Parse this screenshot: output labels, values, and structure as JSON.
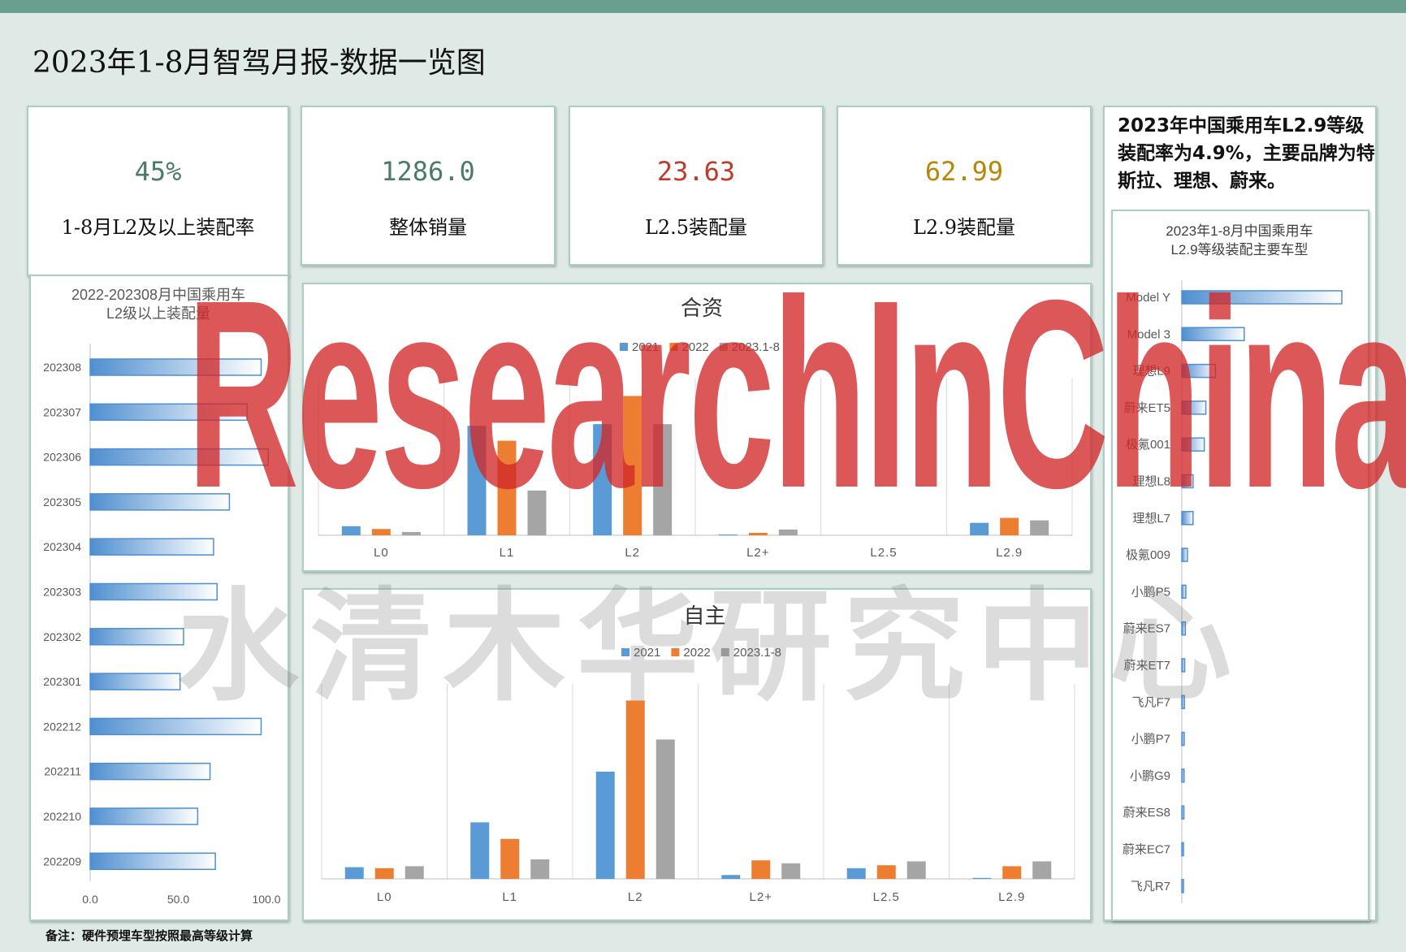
{
  "title": "2023年1-8月智驾月报-数据一览图",
  "kpis": [
    {
      "value": "45%",
      "label": "1-8月L2及以上装配率",
      "color": "#4a7a6a"
    },
    {
      "value": "1286.0",
      "label": "整体销量",
      "color": "#4a7a6a"
    },
    {
      "value": "23.63",
      "label": "L2.5装配量",
      "color": "#c0392b"
    },
    {
      "value": "62.99",
      "label": "L2.9装配量",
      "color": "#b8860b"
    }
  ],
  "summary": "2023年中国乘用车L2.9等级装配率为4.9%，主要品牌为特斯拉、理想、蔚来。",
  "footnote": "备注：硬件预埋车型按照最高等级计算",
  "watermark": {
    "en": "ResearchInChina",
    "cn": "水清木华研究中心"
  },
  "colors": {
    "blue": "#5b9bd5",
    "orange": "#ed7d31",
    "gray": "#a5a5a5"
  },
  "chart_data": [
    {
      "id": "monthly",
      "type": "bar",
      "orientation": "horizontal",
      "title": "2022-202308月中国乘用车L2级以上装配量",
      "title_lines": [
        "2022-202308月中国乘用车",
        "L2级以上装配量"
      ],
      "categories": [
        "202308",
        "202307",
        "202306",
        "202305",
        "202304",
        "202303",
        "202302",
        "202301",
        "202212",
        "202211",
        "202210",
        "202209"
      ],
      "values": [
        97,
        89,
        101,
        79,
        70,
        72,
        53,
        51,
        97,
        68,
        61,
        71
      ],
      "xlim": [
        0,
        100
      ],
      "xticks": [
        "0.0",
        "50.0",
        "100.0"
      ],
      "legend": "none"
    },
    {
      "id": "jv",
      "type": "bar",
      "title": "合资",
      "categories": [
        "L0",
        "L1",
        "L2",
        "L2+",
        "L2.5",
        "L2.9"
      ],
      "series": [
        {
          "name": "2021",
          "values": [
            5.5,
            66,
            67,
            0.5,
            0,
            7.5
          ]
        },
        {
          "name": "2022",
          "values": [
            3.8,
            57,
            84,
            1.5,
            0,
            10.5
          ]
        },
        {
          "name": "2023.1-8",
          "values": [
            2.0,
            27,
            67,
            3.5,
            0,
            9
          ]
        }
      ],
      "ylim": [
        0,
        95
      ],
      "legend": "top"
    },
    {
      "id": "domestic",
      "type": "bar",
      "title": "自主",
      "categories": [
        "L0",
        "L1",
        "L2",
        "L2+",
        "L2.5",
        "L2.9"
      ],
      "series": [
        {
          "name": "2021",
          "values": [
            6,
            29,
            55,
            2,
            5.5,
            0.5
          ]
        },
        {
          "name": "2022",
          "values": [
            5.5,
            20.5,
            91.5,
            9.5,
            7,
            6.5
          ]
        },
        {
          "name": "2023.1-8",
          "values": [
            6.5,
            10,
            71.5,
            8,
            9,
            9
          ]
        }
      ],
      "ylim": [
        0,
        100
      ],
      "legend": "top"
    },
    {
      "id": "models",
      "type": "bar",
      "orientation": "horizontal",
      "title": "2023年1-8月中国乘用车L2.9等级装配主要车型",
      "title_lines": [
        "2023年1-8月中国乘用车",
        "L2.9等级装配主要车型"
      ],
      "categories": [
        "Model Y",
        "Model 3",
        "理想L9",
        "蔚来ET5",
        "极氪001",
        "理想L8",
        "理想L7",
        "极氪009",
        "小鹏P5",
        "蔚来ES7",
        "蔚来ET7",
        "飞凡F7",
        "小鹏P7",
        "小鹏G9",
        "蔚来ES8",
        "蔚来EC7",
        "飞凡R7"
      ],
      "values": [
        100,
        39,
        21,
        15,
        14,
        7,
        7,
        3.5,
        2.5,
        2.2,
        1.8,
        1.6,
        1.5,
        1.4,
        1.3,
        1.0,
        0.7
      ],
      "legend": "none"
    }
  ]
}
